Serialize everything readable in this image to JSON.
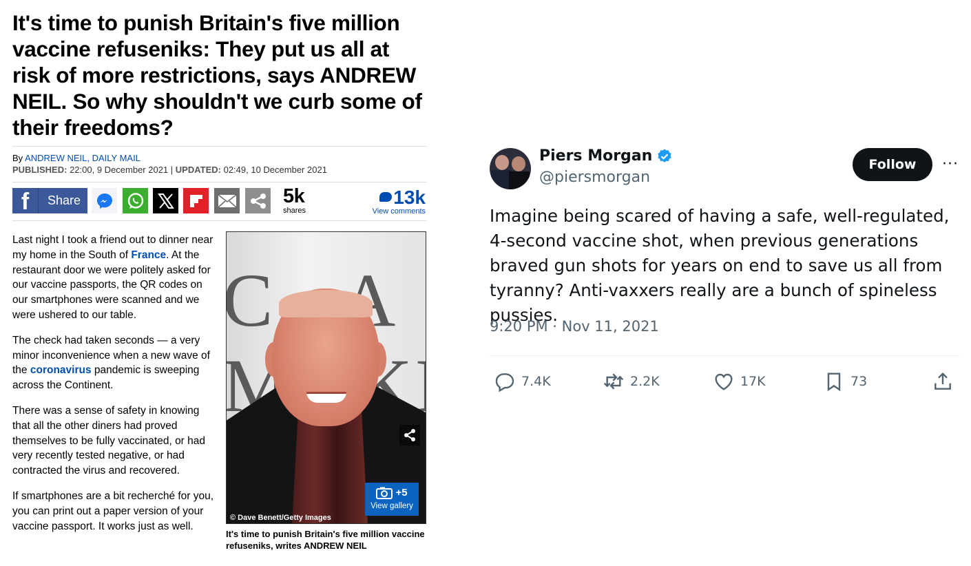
{
  "article": {
    "headline": "It's time to punish Britain's five million vaccine refuseniks: They put us all at risk of more restrictions, says ANDREW NEIL. So why shouldn't we curb some of their freedoms?",
    "byline_prefix": "By ",
    "byline_author": "ANDREW NEIL, DAILY MAIL",
    "published_label": "PUBLISHED:",
    "published_value": " 22:00, 9 December 2021 ",
    "separator": "|",
    "updated_label": " UPDATED:",
    "updated_value": " 02:49, 10 December 2021",
    "share_bar": {
      "facebook_icon": "f",
      "facebook_label": "Share",
      "share_count": "5k",
      "share_count_label": "shares",
      "comment_count": "13k",
      "comment_label": "View comments",
      "icons": [
        "facebook-icon",
        "messenger-icon",
        "whatsapp-icon",
        "x-icon",
        "flipboard-icon",
        "email-icon",
        "share-icon"
      ]
    },
    "paragraphs": [
      {
        "parts": [
          "Last night I took a friend out to dinner near my home in the South of ",
          "France",
          ". At the restaurant door we were politely asked for our vaccine passports, the QR codes on our smartphones were scanned and we were ushered to our table."
        ]
      },
      {
        "parts": [
          "The check had taken seconds — a very minor inconvenience when a new wave of the ",
          "coronavirus",
          " pandemic is sweeping across the Continent."
        ]
      },
      {
        "parts": [
          "There was a sense of safety in knowing that all the other diners had proved themselves to be fully vaccinated, or had very recently tested negative, or had contracted the virus and recovered."
        ]
      },
      {
        "parts": [
          "If smartphones are a bit recherché for you, you can print out a paper version of your vaccine passport. It works just as well."
        ]
      }
    ],
    "photo": {
      "gallery_count": "+5",
      "gallery_label": "View gallery",
      "credit": "© Dave Benett/Getty Images",
      "caption": "It's time to punish Britain's five million vaccine refuseniks, writes ANDREW NEIL"
    }
  },
  "tweet": {
    "name": "Piers Morgan",
    "handle": "@piersmorgan",
    "follow_label": "Follow",
    "more_label": "···",
    "text": "Imagine being scared of having a safe, well-regulated, 4-second vaccine shot, when previous generations braved gun shots for years on end to save us all from tyranny? Anti-vaxxers really are a bunch of spineless pussies.",
    "timestamp": "9:20 PM · Nov 11, 2021",
    "replies": "7.4K",
    "retweets": "2.2K",
    "likes": "17K",
    "bookmarks": "73",
    "colors": {
      "verified": "#1d9bf0",
      "text": "#0f1419",
      "muted": "#536471"
    }
  },
  "colors": {
    "link_blue": "#004db3",
    "facebook": "#3b5998"
  }
}
